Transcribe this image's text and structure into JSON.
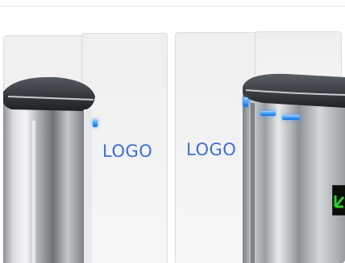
{
  "left_logo": "LOGO",
  "right_logo": "LOGO",
  "colors": {
    "logo_blue": "#3c6fd8",
    "led_blue": "#3aa0ff",
    "display_green": "#2bd02b"
  },
  "icons": {
    "display": "green-arrow-icon"
  }
}
